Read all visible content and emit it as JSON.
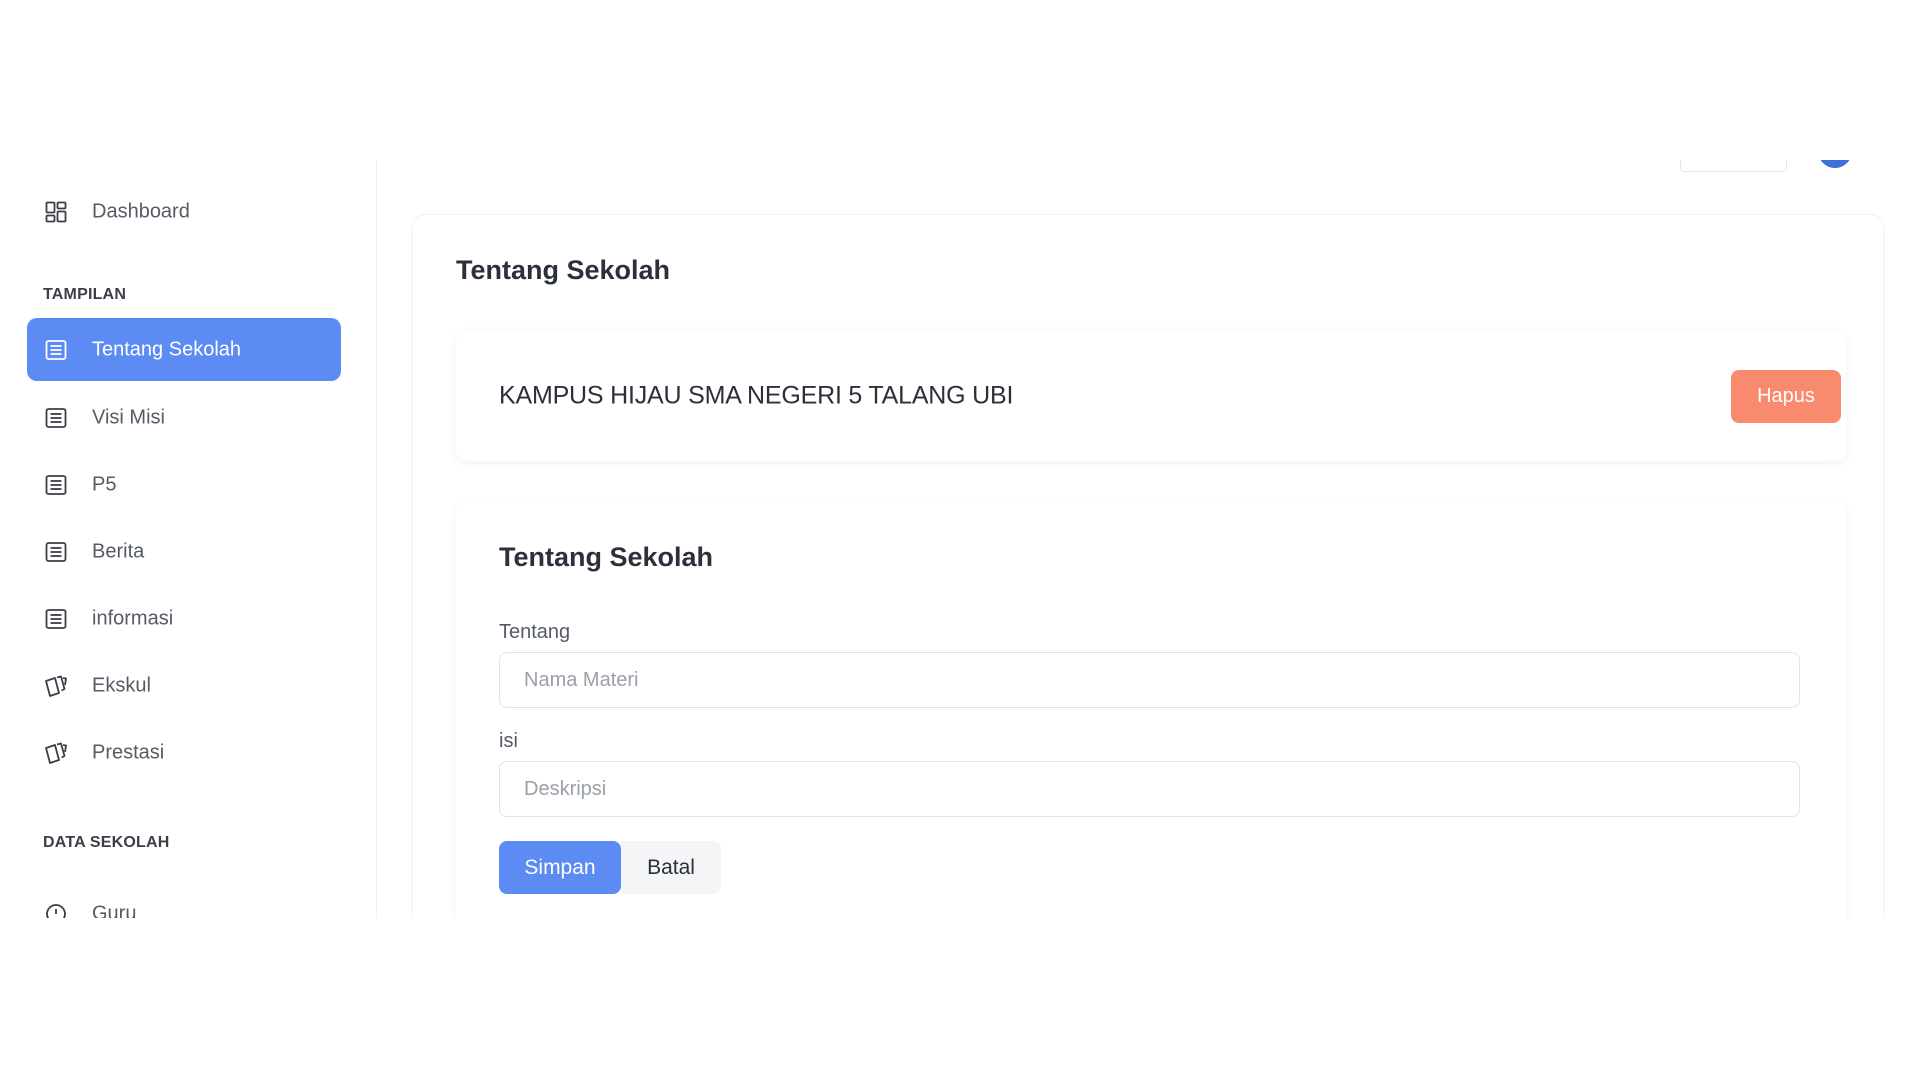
{
  "sidebar": {
    "dashboard": {
      "label": "Dashboard",
      "icon": "grid-icon"
    },
    "sections": [
      {
        "heading": "TAMPILAN"
      },
      {
        "heading": "DATA SEKOLAH"
      }
    ],
    "items": [
      {
        "label": "Tentang Sekolah",
        "icon": "list-icon",
        "active": true
      },
      {
        "label": "Visi Misi",
        "icon": "list-icon"
      },
      {
        "label": "P5",
        "icon": "list-icon"
      },
      {
        "label": "Berita",
        "icon": "list-icon"
      },
      {
        "label": "informasi",
        "icon": "list-icon"
      },
      {
        "label": "Ekskul",
        "icon": "cards-icon"
      },
      {
        "label": "Prestasi",
        "icon": "cards-icon"
      },
      {
        "label": "Guru",
        "icon": "circle-icon"
      }
    ]
  },
  "main": {
    "title": "Tentang Sekolah",
    "item": {
      "title": "KAMPUS HIJAU SMA NEGERI 5 TALANG UBI",
      "delete_label": "Hapus"
    },
    "form": {
      "title": "Tentang Sekolah",
      "about_label": "Tentang",
      "about_placeholder": "Nama Materi",
      "content_label": "isi",
      "content_placeholder": "Deskripsi",
      "save_label": "Simpan",
      "cancel_label": "Batal"
    }
  },
  "colors": {
    "accent": "#5b8bf3",
    "danger": "#f88a6e"
  }
}
